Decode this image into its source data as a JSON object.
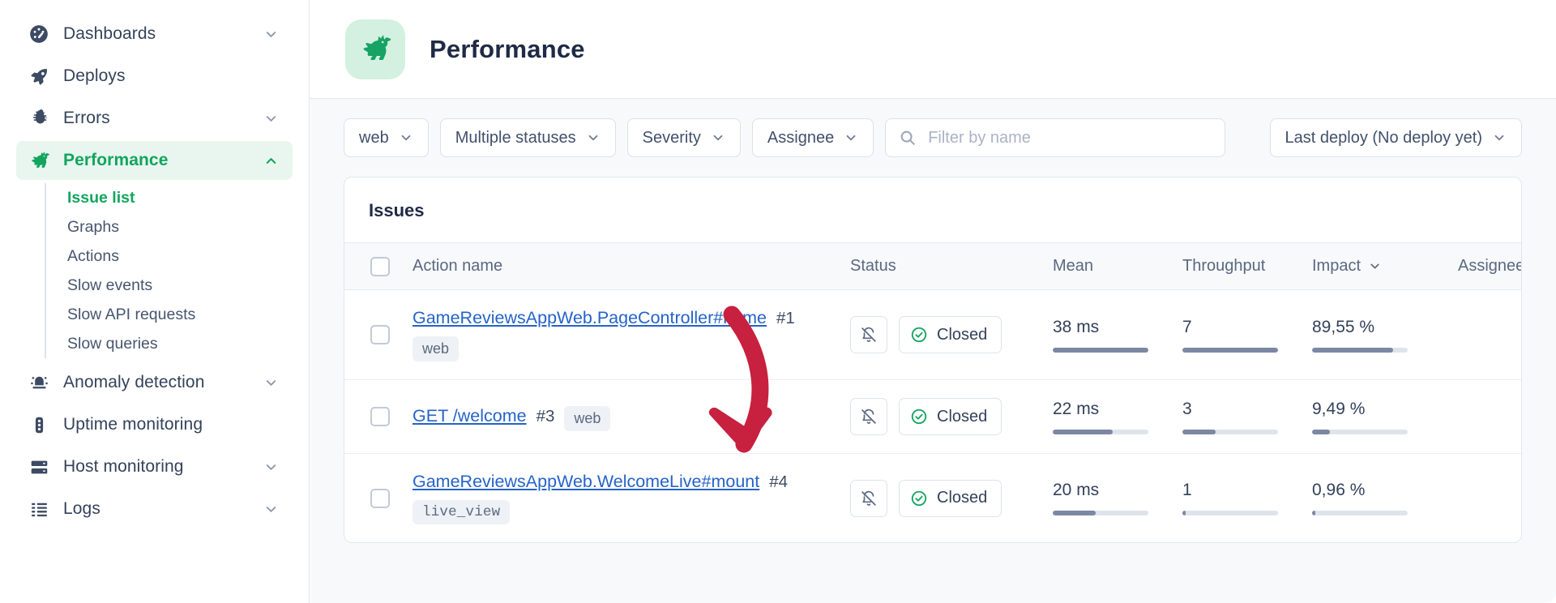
{
  "sidebar": {
    "items": [
      {
        "label": "Dashboards",
        "icon": "gauge-icon",
        "chevron": "down",
        "active": false
      },
      {
        "label": "Deploys",
        "icon": "rocket-icon",
        "chevron": "none",
        "active": false
      },
      {
        "label": "Errors",
        "icon": "bug-icon",
        "chevron": "down",
        "active": false
      },
      {
        "label": "Performance",
        "icon": "rabbit-icon",
        "chevron": "up",
        "active": true
      },
      {
        "label": "Anomaly detection",
        "icon": "siren-icon",
        "chevron": "down",
        "active": false
      },
      {
        "label": "Uptime monitoring",
        "icon": "traffic-light-icon",
        "chevron": "none",
        "active": false
      },
      {
        "label": "Host monitoring",
        "icon": "server-icon",
        "chevron": "down",
        "active": false
      },
      {
        "label": "Logs",
        "icon": "logs-icon",
        "chevron": "down",
        "active": false
      }
    ],
    "subnav": [
      {
        "label": "Issue list",
        "current": true
      },
      {
        "label": "Graphs",
        "current": false
      },
      {
        "label": "Actions",
        "current": false
      },
      {
        "label": "Slow events",
        "current": false
      },
      {
        "label": "Slow API requests",
        "current": false
      },
      {
        "label": "Slow queries",
        "current": false
      }
    ]
  },
  "header": {
    "title": "Performance",
    "logo_icon": "rabbit-icon"
  },
  "filters": {
    "namespace": "web",
    "statuses": "Multiple statuses",
    "severity": "Severity",
    "assignee": "Assignee",
    "search_placeholder": "Filter by name",
    "search_value": "",
    "deploy": "Last deploy (No deploy yet)"
  },
  "table": {
    "title": "Issues",
    "columns": [
      "Action name",
      "Status",
      "Mean",
      "Throughput",
      "Impact",
      "Assignees"
    ],
    "impact_sorted": true,
    "rows": [
      {
        "name": "GameReviewsAppWeb.PageController#home",
        "number": "#1",
        "tag": "web",
        "tag_mono": false,
        "tag_inline": false,
        "mute_icon": "bell-off-icon",
        "status": "Closed",
        "status_icon": "check-circle-icon",
        "mean": "38 ms",
        "mean_pct": 100,
        "throughput": "7",
        "throughput_pct": 100,
        "impact": "89,55 %",
        "impact_pct": 85,
        "assignees": ""
      },
      {
        "name": "GET /welcome",
        "number": "#3",
        "tag": "web",
        "tag_mono": false,
        "tag_inline": true,
        "mute_icon": "bell-off-icon",
        "status": "Closed",
        "status_icon": "check-circle-icon",
        "mean": "22 ms",
        "mean_pct": 63,
        "throughput": "3",
        "throughput_pct": 35,
        "impact": "9,49 %",
        "impact_pct": 19,
        "assignees": ""
      },
      {
        "name": "GameReviewsAppWeb.WelcomeLive#mount",
        "number": "#4",
        "tag": "live_view",
        "tag_mono": true,
        "tag_inline": false,
        "mute_icon": "bell-off-icon",
        "status": "Closed",
        "status_icon": "check-circle-icon",
        "mean": "20 ms",
        "mean_pct": 45,
        "throughput": "1",
        "throughput_pct": 3,
        "impact": "0,96 %",
        "impact_pct": 3,
        "assignees": ""
      }
    ]
  },
  "annotation": {
    "type": "curved-arrow",
    "color": "#c8203f",
    "points_to": "GameReviewsAppWeb.WelcomeLive#mount"
  },
  "colors": {
    "accent_green": "#12a55e",
    "link_blue": "#2563c9",
    "text_dark": "#1f2a44",
    "bar_gray": "#7b87a3",
    "annotation_red": "#c8203f"
  }
}
